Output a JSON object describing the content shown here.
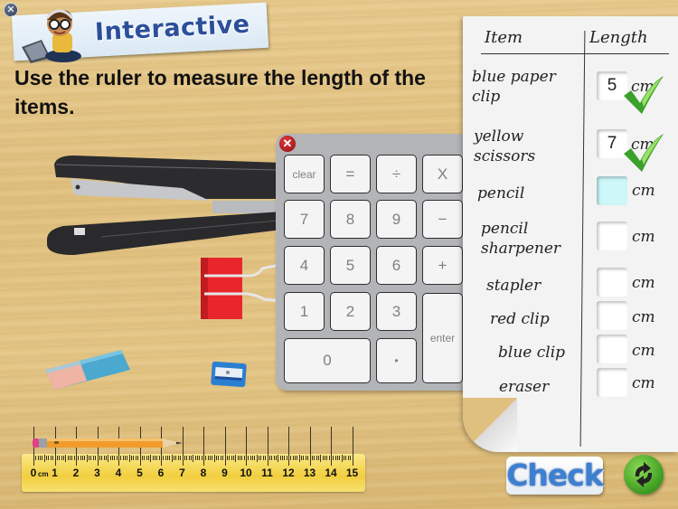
{
  "app": {
    "banner_title": "Interactive",
    "close_icon": "close-circle-icon"
  },
  "instruction": "Use the ruler to measure the length of  the items.",
  "keypad": {
    "close_icon": "close-red-icon",
    "keys": {
      "clear": "clear",
      "equals": "=",
      "divide": "÷",
      "multiply": "X",
      "seven": "7",
      "eight": "8",
      "nine": "9",
      "minus": "−",
      "four": "4",
      "five": "5",
      "six": "6",
      "plus": "+",
      "one": "1",
      "two": "2",
      "three": "3",
      "enter": "enter",
      "zero": "0",
      "dot": "•"
    }
  },
  "worksheet": {
    "header_item": "Item",
    "header_length": "Length",
    "unit": "cm",
    "rows": [
      {
        "line1": "blue paper",
        "line2": "clip",
        "value": "5",
        "status": "correct"
      },
      {
        "line1": "yellow",
        "line2": "scissors",
        "value": "7",
        "status": "correct"
      },
      {
        "line1": "pencil",
        "line2": "",
        "value": "",
        "status": "active"
      },
      {
        "line1": "pencil",
        "line2": "sharpener",
        "value": "",
        "status": "empty"
      },
      {
        "line1": "stapler",
        "line2": "",
        "value": "",
        "status": "empty"
      },
      {
        "line1": "red clip",
        "line2": "",
        "value": "",
        "status": "empty"
      },
      {
        "line1": "blue clip",
        "line2": "",
        "value": "",
        "status": "empty"
      },
      {
        "line1": "eraser",
        "line2": "",
        "value": "",
        "status": "empty"
      }
    ]
  },
  "ruler": {
    "unit_label": "cm",
    "numbers": [
      "0",
      "1",
      "2",
      "3",
      "4",
      "5",
      "6",
      "7",
      "8",
      "9",
      "10",
      "11",
      "12",
      "13",
      "14",
      "15"
    ],
    "color": "#f4d755"
  },
  "buttons": {
    "check": "Check",
    "reset_icon": "refresh-arrows-icon"
  },
  "colors": {
    "banner_text": "#2c4f9a",
    "check_text": "#3d7fd0",
    "reset_green": "#3b9a1f",
    "active_input": "#cdf7f8",
    "correct_check": "#3aa12a"
  }
}
